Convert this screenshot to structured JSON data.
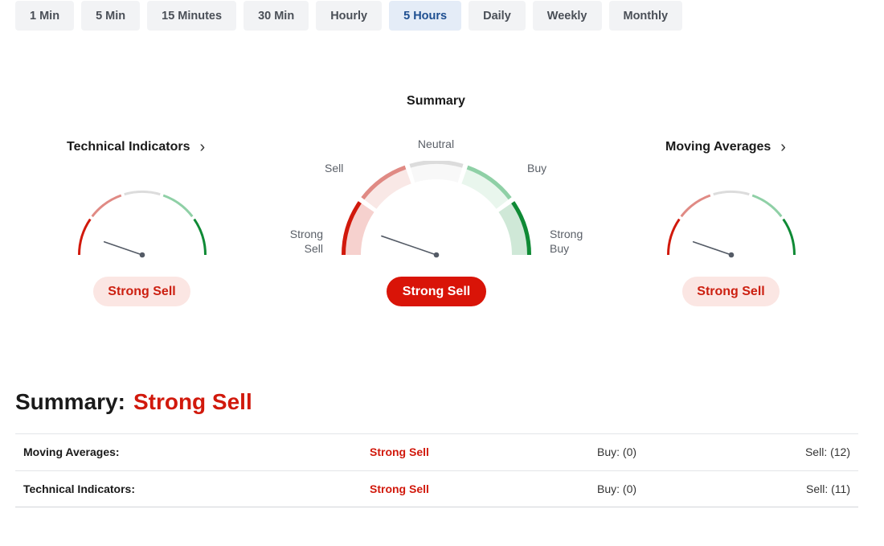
{
  "timeframes": [
    {
      "label": "1 Min"
    },
    {
      "label": "5 Min"
    },
    {
      "label": "15 Minutes"
    },
    {
      "label": "30 Min"
    },
    {
      "label": "Hourly"
    },
    {
      "label": "5 Hours",
      "active": true
    },
    {
      "label": "Daily"
    },
    {
      "label": "Weekly"
    },
    {
      "label": "Monthly"
    }
  ],
  "gauges": {
    "summary_title": "Summary",
    "technical": {
      "title": "Technical Indicators",
      "verdict": "Strong Sell"
    },
    "main": {
      "verdict": "Strong Sell",
      "labels": {
        "neutral": "Neutral",
        "sell": "Sell",
        "buy": "Buy",
        "strong_sell": "Strong\nSell",
        "strong_buy": "Strong\nBuy"
      }
    },
    "moving": {
      "title": "Moving Averages",
      "verdict": "Strong Sell"
    }
  },
  "summary": {
    "heading": "Summary:",
    "verdict": "Strong Sell",
    "rows": [
      {
        "name": "Moving Averages:",
        "verdict": "Strong Sell",
        "buy": "Buy: (0)",
        "sell": "Sell: (12)"
      },
      {
        "name": "Technical Indicators:",
        "verdict": "Strong Sell",
        "buy": "Buy: (0)",
        "sell": "Sell: (11)"
      }
    ]
  },
  "colors": {
    "strong_sell": "#d1190c",
    "sell": "#e08a84",
    "neutral": "#dcdcdc",
    "buy": "#8fd0a6",
    "strong_buy": "#0f8a35",
    "needle": "#545b66",
    "active_tab_bg": "#e4ecf7",
    "active_tab_text": "#1e4f91"
  }
}
